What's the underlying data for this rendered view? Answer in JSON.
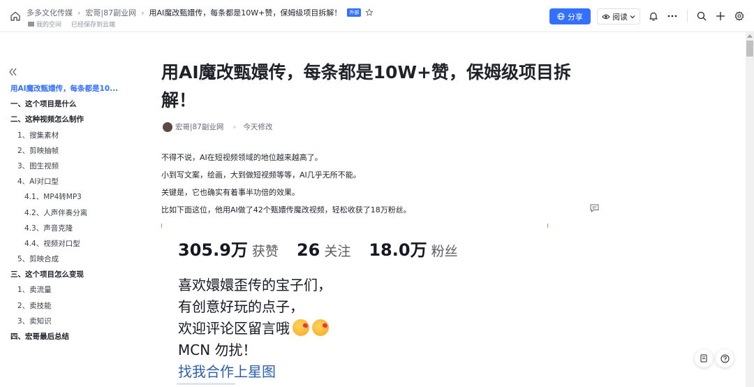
{
  "breadcrumb": {
    "items": [
      "多多文化传媒",
      "宏哥|87副业网",
      "用AI魔改甄嬛传，每条都是10W+赞，保姆级项目拆解！"
    ],
    "tag": "外部"
  },
  "sub_breadcrumb": {
    "space_label": "我的空间",
    "saved_label": "已经保存到云端"
  },
  "toolbar": {
    "share_label": "分享",
    "read_label": "阅读"
  },
  "toc": [
    {
      "label": "用AI魔改甄嬛传，每条都是10...",
      "level": 1,
      "active": true
    },
    {
      "label": "一、这个项目是什么",
      "level": 1
    },
    {
      "label": "二、这种视频怎么制作",
      "level": 1
    },
    {
      "label": "1、搜集素材",
      "level": 2
    },
    {
      "label": "2、剪映抽帧",
      "level": 2
    },
    {
      "label": "3、图生视频",
      "level": 2
    },
    {
      "label": "4、AI对口型",
      "level": 2
    },
    {
      "label": "4.1、MP4转MP3",
      "level": 3
    },
    {
      "label": "4.2、人声伴奏分离",
      "level": 3
    },
    {
      "label": "4.3、声音克隆",
      "level": 3
    },
    {
      "label": "4.4、视频对口型",
      "level": 3
    },
    {
      "label": "5、剪映合成",
      "level": 2
    },
    {
      "label": "三、这个项目怎么变现",
      "level": 1
    },
    {
      "label": "1、卖流量",
      "level": 2
    },
    {
      "label": "2、卖技能",
      "level": 2
    },
    {
      "label": "3、卖知识",
      "level": 2
    },
    {
      "label": "四、宏哥最后总结",
      "level": 1
    }
  ],
  "doc": {
    "title": "用AI魔改甄嬛传，每条都是10W+赞，保姆级项目拆解！",
    "author": "宏哥|87副业网",
    "modified": "今天修改",
    "paragraphs": [
      "不得不说，AI在短视频领域的地位越来越高了。",
      "小到写文案，绘画，大到做短视频等等，AI几乎无所不能。",
      "关键是，它也确实有着事半功倍的效果。",
      "比如下面这位，他用AI做了42个甄嬛传魔改视频，轻松收获了18万粉丝。"
    ]
  },
  "embed": {
    "stats": [
      {
        "value": "305.9万",
        "label": "获赞"
      },
      {
        "value": "26",
        "label": "关注"
      },
      {
        "value": "18.0万",
        "label": "粉丝"
      }
    ],
    "bio_lines": [
      "喜欢嬛嬛歪传的宝子们，",
      "有创意好玩的点子，",
      "欢迎评论区留言哦",
      "MCN 勿扰！"
    ],
    "link_line": "找我合作上星图"
  },
  "colors": {
    "accent": "#3370ff",
    "link": "#2b5fae",
    "text": "#1f2329"
  }
}
